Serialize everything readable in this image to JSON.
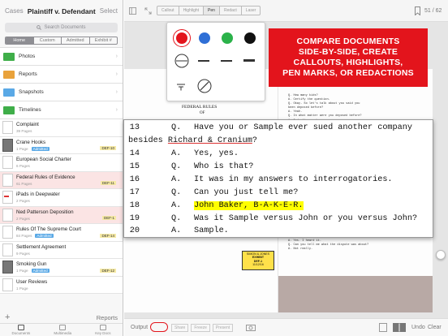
{
  "sidebar": {
    "cases_label": "Cases",
    "title": "Plaintiff v. Defendant",
    "select_label": "Select",
    "search_placeholder": "Search Documents",
    "segments": [
      "Home",
      "Custom",
      "Admitted",
      "Exhibit #"
    ],
    "folders": [
      {
        "label": "Photos",
        "color": "#3fae49"
      },
      {
        "label": "Reports",
        "color": "#e9a23b"
      },
      {
        "label": "Snapshots",
        "color": "#5aa9e6"
      },
      {
        "label": "Timelines",
        "color": "#3fae49"
      }
    ],
    "docs": [
      {
        "name": "Complaint",
        "sub": "39 Pages",
        "admitted": "",
        "exhibit": ""
      },
      {
        "name": "Crane Hooks",
        "sub": "1 Page",
        "admitted": "Admitted",
        "exhibit": "DEF-10"
      },
      {
        "name": "European Social Charter",
        "sub": "6 Pages",
        "admitted": "",
        "exhibit": ""
      },
      {
        "name": "Federal Rules of Evidence",
        "sub": "61 Pages",
        "admitted": "",
        "exhibit": "DEF-11"
      },
      {
        "name": "iPads in Deepwater",
        "sub": "2 Pages",
        "admitted": "",
        "exhibit": ""
      },
      {
        "name": "Ned Patterson Deposition",
        "sub": "2 Pages",
        "admitted": "",
        "exhibit": "DEF-1"
      },
      {
        "name": "Rules Of The Supreme Court",
        "sub": "84 Pages",
        "admitted": "Admitted",
        "exhibit": "DEF-14"
      },
      {
        "name": "Settlement Agreement",
        "sub": "9 Pages",
        "admitted": "",
        "exhibit": ""
      },
      {
        "name": "Smoking Gun",
        "sub": "1 Page",
        "admitted": "Admitted",
        "exhibit": "DEF-12"
      },
      {
        "name": "User Reviews",
        "sub": "1 Page",
        "admitted": "",
        "exhibit": ""
      }
    ],
    "add_label": "+",
    "reports_label": "Reports",
    "tabs": [
      "Documents",
      "Multimedia",
      "Key Docs"
    ]
  },
  "toolbar": {
    "tools": [
      "Callout",
      "Highlight",
      "Pen",
      "Redact",
      "Laser"
    ],
    "page_counter": "51 / 62"
  },
  "palette": {
    "colors": [
      "#e3141c",
      "#2f6fd6",
      "#2bb24a",
      "#111111"
    ]
  },
  "banner": {
    "lines": [
      "COMPARE DOCUMENTS",
      "SIDE-BY-SIDE, CREATE",
      "CALLOUTS, HIGHLIGHTS,",
      "PEN MARKS, OR REDACTIONS"
    ]
  },
  "left_page": {
    "heading1": "FEDERAL RULES",
    "heading2": "OF"
  },
  "right_page": {
    "top_lines": [
      "Q.    How many kids?",
      "A.    Certify the question.",
      "Q.    Okay.  So let's talk about you said you",
      "been deposed before?",
      "A.    Yeah.",
      "Q.    In what matter were you deposed before?",
      "A.    I don't remember."
    ],
    "bottom_lines": [
      "A.    Yes.  I heard it.",
      "Q.    Can you tell me what the dispute was about?",
      "A.    Not really."
    ]
  },
  "callout_lines": [
    {
      "num": "13",
      "speaker": "Q.",
      "text": "Have you or Sample ever sued another company"
    },
    {
      "num": "",
      "speaker": "",
      "text_pre": "besides ",
      "text_ul": "Richard & Cranium",
      "text_post": "?"
    },
    {
      "num": "14",
      "speaker": "A.",
      "text": "Yes, yes."
    },
    {
      "num": "15",
      "speaker": "Q.",
      "text": "Who is that?"
    },
    {
      "num": "16",
      "speaker": "A.",
      "text": "It was in my answers to interrogatories."
    },
    {
      "num": "17",
      "speaker": "Q.",
      "text": "Can you just tell me?"
    },
    {
      "num": "18",
      "speaker": "A.",
      "text": "John Baker, B-A-K-E-R.",
      "highlight": true
    },
    {
      "num": "19",
      "speaker": "Q.",
      "text": "Was it Sample versus John or you versus John?"
    },
    {
      "num": "20",
      "speaker": "A.",
      "text": "Sample."
    }
  ],
  "sticker": {
    "lines": [
      "SIMON & JONES",
      "EXHIBIT",
      "DEF-1",
      "11/12/16"
    ]
  },
  "footer": {
    "output_label": "Output",
    "buttons": [
      "Share",
      "Freeze",
      "Present"
    ],
    "undo_label": "Undo",
    "clear_label": "Clear"
  }
}
